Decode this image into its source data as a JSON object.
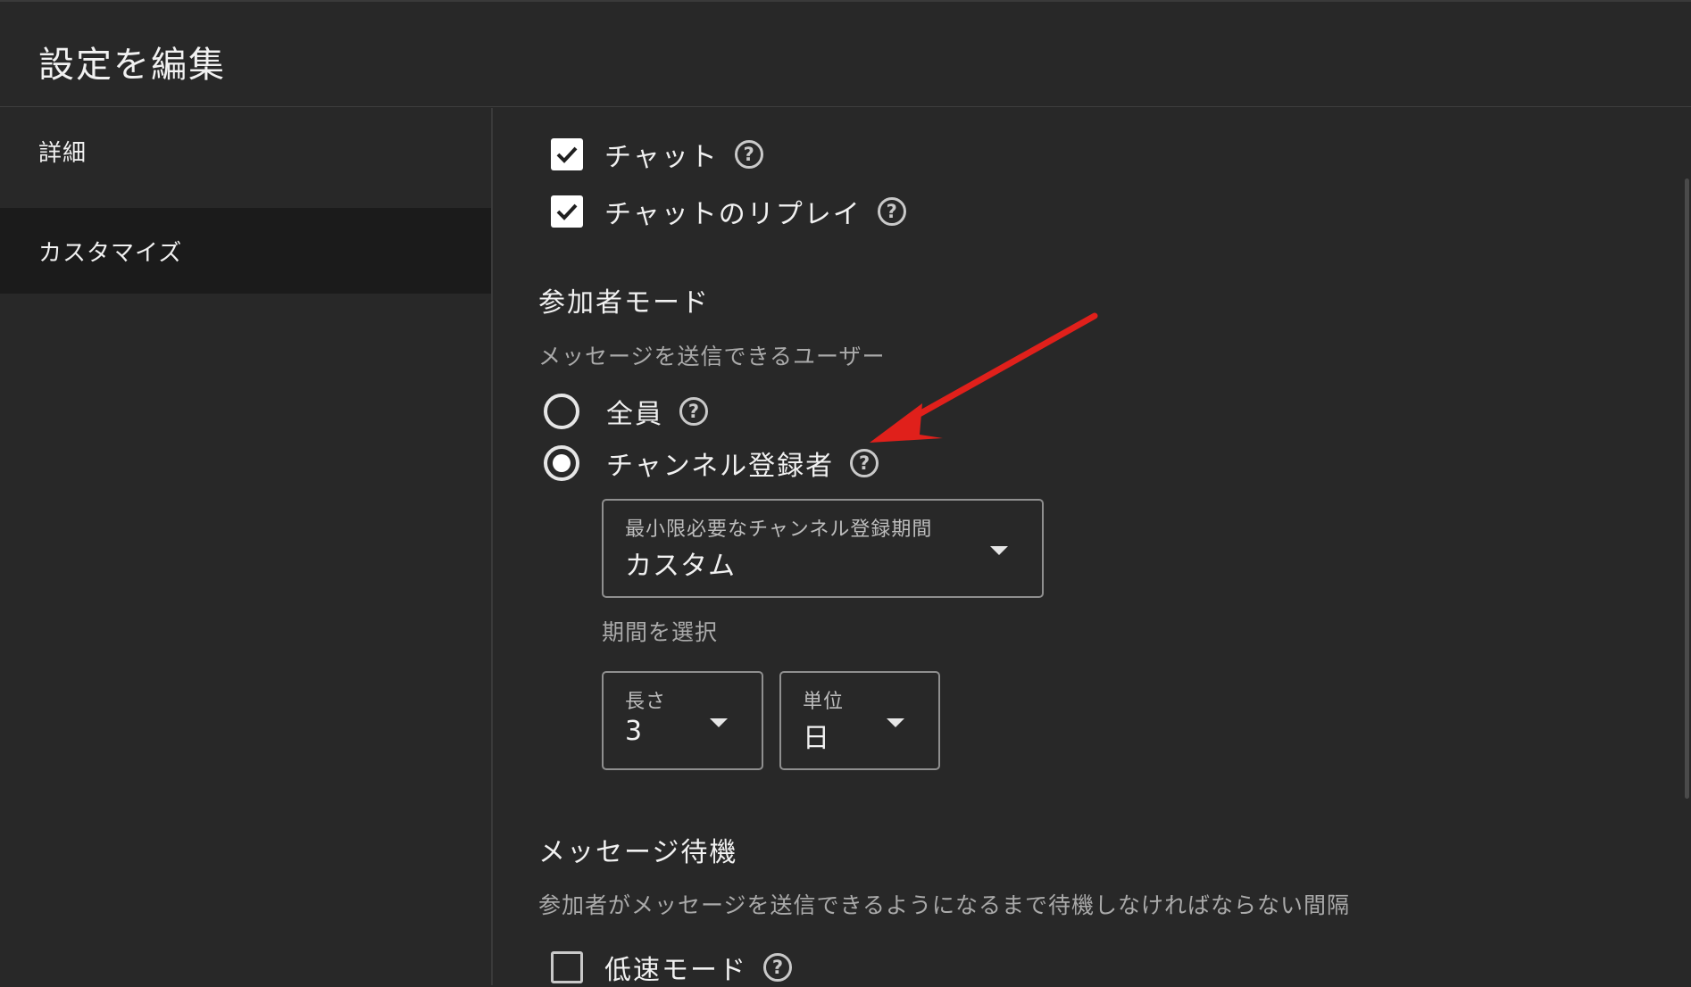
{
  "dialog": {
    "title": "設定を編集"
  },
  "sidebar": {
    "items": [
      {
        "label": "詳細",
        "active": false
      },
      {
        "label": "カスタマイズ",
        "active": true
      }
    ]
  },
  "chat": {
    "chat_label": "チャット",
    "chat_checked": true,
    "replay_label": "チャットのリプレイ",
    "replay_checked": true
  },
  "participant_mode": {
    "title": "参加者モード",
    "subtitle": "メッセージを送信できるユーザー",
    "options": [
      {
        "label": "全員",
        "selected": false
      },
      {
        "label": "チャンネル登録者",
        "selected": true
      }
    ],
    "min_period": {
      "label": "最小限必要なチャンネル登録期間",
      "value": "カスタム"
    },
    "period_select_label": "期間を選択",
    "length": {
      "label": "長さ",
      "value": "3"
    },
    "unit": {
      "label": "単位",
      "value": "日"
    }
  },
  "message_wait": {
    "title": "メッセージ待機",
    "subtitle": "参加者がメッセージを送信できるようになるまで待機しなければならない間隔",
    "slow_mode_label": "低速モード",
    "slow_mode_checked": false
  },
  "colors": {
    "background": "#282828",
    "selected_nav": "#1b1b1b",
    "annotation_arrow": "#e0201b"
  },
  "icons": {
    "help": "help-circle-icon",
    "check": "check-icon",
    "dropdown": "caret-down-icon"
  }
}
